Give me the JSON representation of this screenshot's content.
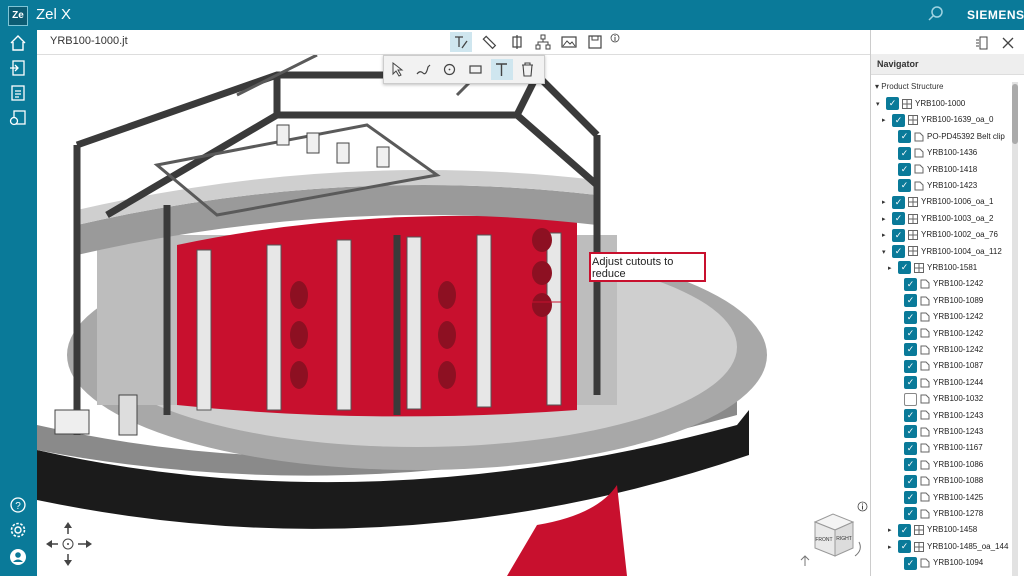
{
  "app": {
    "logo": "Ze",
    "title": "Zel X",
    "brand": "SIEMENS"
  },
  "icons": {
    "leftbar": [
      "home-icon",
      "import-icon",
      "report-icon",
      "workflow-icon",
      "help-icon",
      "settings-icon",
      "user-icon"
    ],
    "toolbar": [
      "markup-icon",
      "measure-icon",
      "section-icon",
      "structure-icon",
      "image-icon",
      "save-icon",
      "info-icon"
    ],
    "subtools": [
      "select-icon",
      "freehand-icon",
      "circle-icon",
      "rectangle-icon",
      "text-icon",
      "delete-icon"
    ]
  },
  "tab": {
    "title": "YRB100-1000.jt"
  },
  "annotation": {
    "text": "Adjust cutouts to reduce"
  },
  "colors": {
    "accent": "#0a7a99",
    "annotation": "#c8102e",
    "model_red": "#c8102e"
  },
  "navigator": {
    "title": "Navigator",
    "section": "Product Structure",
    "items": [
      {
        "label": "YRB100-1000",
        "expander": "▾",
        "checked": true
      },
      {
        "label": "YRB100-1639_oa_0",
        "expander": "▸",
        "checked": true
      },
      {
        "label": "PO-PD45392 Belt clip",
        "expander": "",
        "checked": true
      },
      {
        "label": "YRB100-1436",
        "expander": "",
        "checked": true
      },
      {
        "label": "YRB100-1418",
        "expander": "",
        "checked": true
      },
      {
        "label": "YRB100-1423",
        "expander": "",
        "checked": true
      },
      {
        "label": "YRB100-1006_oa_1",
        "expander": "▸",
        "checked": true
      },
      {
        "label": "YRB100-1003_oa_2",
        "expander": "▸",
        "checked": true
      },
      {
        "label": "YRB100-1002_oa_76",
        "expander": "▸",
        "checked": true
      },
      {
        "label": "YRB100-1004_oa_112",
        "expander": "▾",
        "checked": true
      },
      {
        "label": "YRB100-1581",
        "expander": "▸",
        "checked": true
      },
      {
        "label": "YRB100-1242",
        "expander": "",
        "checked": true
      },
      {
        "label": "YRB100-1089",
        "expander": "",
        "checked": true
      },
      {
        "label": "YRB100-1242",
        "expander": "",
        "checked": true
      },
      {
        "label": "YRB100-1242",
        "expander": "",
        "checked": true
      },
      {
        "label": "YRB100-1242",
        "expander": "",
        "checked": true
      },
      {
        "label": "YRB100-1087",
        "expander": "",
        "checked": true
      },
      {
        "label": "YRB100-1244",
        "expander": "",
        "checked": true
      },
      {
        "label": "YRB100-1032",
        "expander": "",
        "checked": false
      },
      {
        "label": "YRB100-1243",
        "expander": "",
        "checked": true
      },
      {
        "label": "YRB100-1243",
        "expander": "",
        "checked": true
      },
      {
        "label": "YRB100-1167",
        "expander": "",
        "checked": true
      },
      {
        "label": "YRB100-1086",
        "expander": "",
        "checked": true
      },
      {
        "label": "YRB100-1088",
        "expander": "",
        "checked": true
      },
      {
        "label": "YRB100-1425",
        "expander": "",
        "checked": true
      },
      {
        "label": "YRB100-1278",
        "expander": "",
        "checked": true
      },
      {
        "label": "YRB100-1458",
        "expander": "▸",
        "checked": true
      },
      {
        "label": "YRB100-1485_oa_144",
        "expander": "▸",
        "checked": true
      },
      {
        "label": "YRB100-1094",
        "expander": "",
        "checked": true
      }
    ]
  },
  "viewcube": {
    "front": "FRONT",
    "right": "RIGHT"
  }
}
